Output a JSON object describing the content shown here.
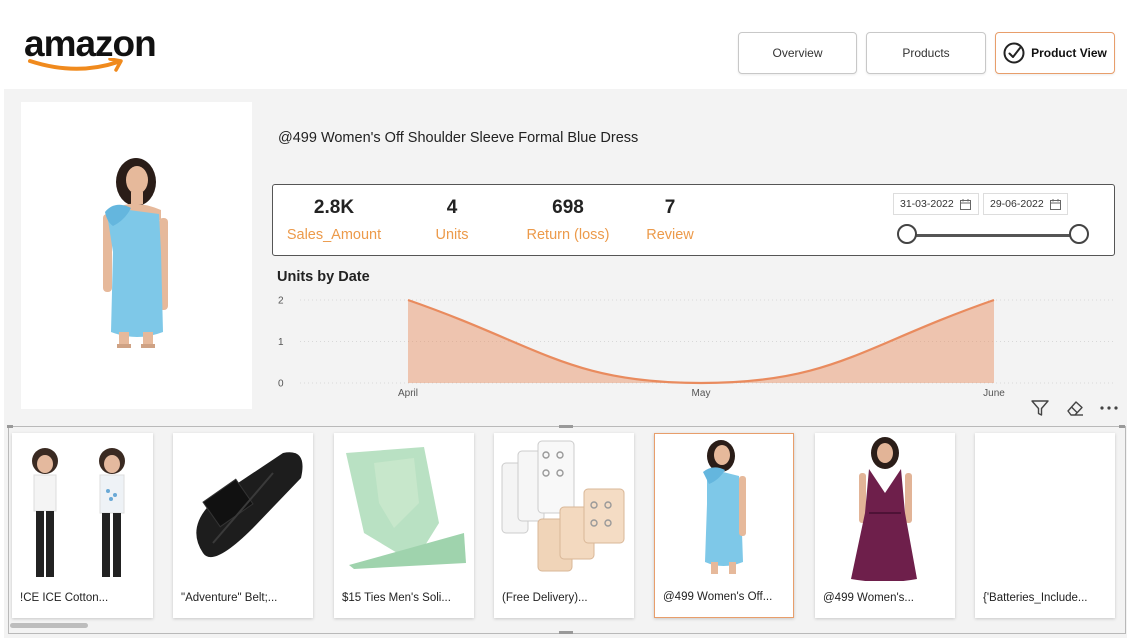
{
  "brand": {
    "logo_text": "amazon"
  },
  "nav": {
    "overview_label": "Overview",
    "products_label": "Products",
    "product_view_label": "Product View"
  },
  "product": {
    "title": "@499 Women's Off Shoulder Sleeve Formal Blue Dress"
  },
  "kpis": {
    "sales_value": "2.8K",
    "sales_label": "Sales_Amount",
    "units_value": "4",
    "units_label": "Units",
    "return_value": "698",
    "return_label": "Return (loss)",
    "review_value": "7",
    "review_label": "Review"
  },
  "date_slicer": {
    "start": "31-03-2022",
    "end": "29-06-2022"
  },
  "chart_data": {
    "type": "area",
    "title": "Units by Date",
    "x": [
      "April",
      "May",
      "June"
    ],
    "series": [
      {
        "values": [
          2,
          0,
          2
        ]
      }
    ],
    "ylim": [
      0,
      2
    ],
    "yticks": [
      "0",
      "1",
      "2"
    ],
    "grid": true,
    "color": "#e98b5e"
  },
  "visual_icons": [
    "filter-icon",
    "eraser-icon",
    "more-options-icon"
  ],
  "gallery": {
    "items": [
      {
        "caption": "!CE ICE Cotton..."
      },
      {
        "caption": "\"Adventure\" Belt;..."
      },
      {
        "caption": "$15 Ties Men's Soli..."
      },
      {
        "caption": "(Free Delivery)..."
      },
      {
        "caption": "@499 Women's Off..."
      },
      {
        "caption": "@499 Women's..."
      },
      {
        "caption": "{'Batteries_Include..."
      }
    ]
  },
  "colors": {
    "accent": "#ec9a4a",
    "selected_border": "#e89e6b",
    "dress_blue": "#7ec8e8"
  }
}
